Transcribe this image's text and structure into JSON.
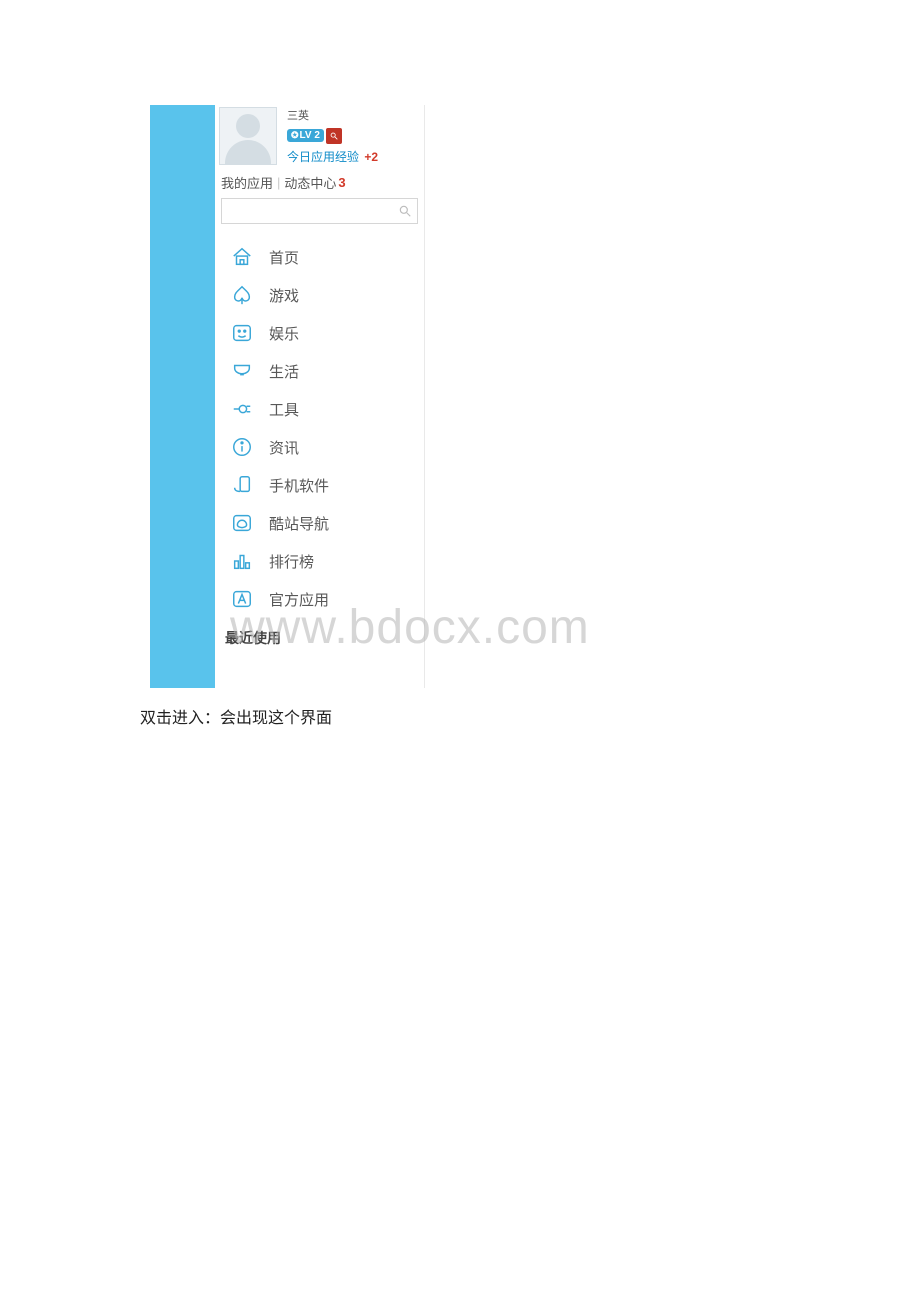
{
  "user": {
    "nickname_fragment": "三英",
    "level_badge": "LV 2",
    "xp_label": "今日应用经验",
    "xp_delta": "+2"
  },
  "tabs": {
    "my_apps": "我的应用",
    "activity": "动态中心",
    "activity_count": "3"
  },
  "search": {
    "placeholder": ""
  },
  "nav": [
    {
      "key": "home",
      "label": "首页"
    },
    {
      "key": "games",
      "label": "游戏"
    },
    {
      "key": "ent",
      "label": "娱乐"
    },
    {
      "key": "life",
      "label": "生活"
    },
    {
      "key": "tools",
      "label": "工具"
    },
    {
      "key": "news",
      "label": "资讯"
    },
    {
      "key": "mobile",
      "label": "手机软件"
    },
    {
      "key": "coolnav",
      "label": "酷站导航"
    },
    {
      "key": "rank",
      "label": "排行榜"
    },
    {
      "key": "official",
      "label": "官方应用"
    }
  ],
  "section_recent": "最近使用",
  "watermark": "www.bdocx.com",
  "caption": "双击进入：会出现这个界面"
}
